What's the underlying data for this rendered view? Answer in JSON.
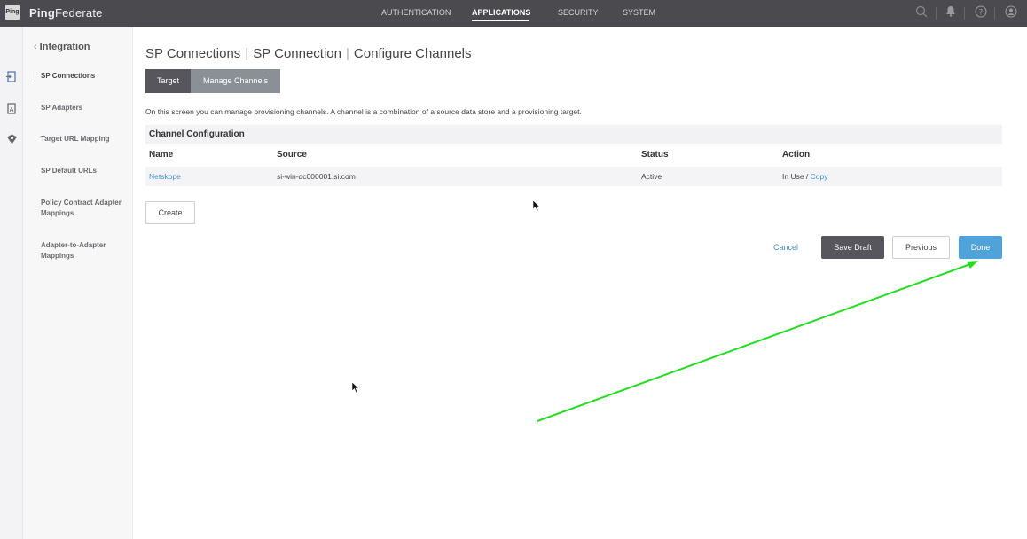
{
  "brand": {
    "logo_text": "Ping",
    "name_bold": "Ping",
    "name_rest": "Federate"
  },
  "topnav": {
    "items": [
      {
        "label": "AUTHENTICATION",
        "active": false
      },
      {
        "label": "APPLICATIONS",
        "active": true
      },
      {
        "label": "SECURITY",
        "active": false
      },
      {
        "label": "SYSTEM",
        "active": false
      }
    ],
    "icons": [
      "search-icon",
      "bell-icon",
      "help-icon",
      "user-icon"
    ]
  },
  "leftrail": {
    "icons": [
      "applications-icon",
      "adapters-icon",
      "integration-icon"
    ]
  },
  "sidebar": {
    "back_label": "Integration",
    "items": [
      {
        "label": "SP Connections",
        "active": true
      },
      {
        "label": "SP Adapters",
        "active": false
      },
      {
        "label": "Target URL Mapping",
        "active": false
      },
      {
        "label": "SP Default URLs",
        "active": false
      },
      {
        "label": "Policy Contract Adapter Mappings",
        "active": false
      },
      {
        "label": "Adapter-to-Adapter Mappings",
        "active": false
      }
    ]
  },
  "breadcrumb": {
    "items": [
      "SP Connections",
      "SP Connection",
      "Configure Channels"
    ]
  },
  "tabs": [
    {
      "label": "Target"
    },
    {
      "label": "Manage Channels"
    }
  ],
  "description": "On this screen you can manage provisioning channels. A channel is a combination of a source data store and a provisioning target.",
  "channel_config": {
    "title": "Channel Configuration",
    "columns": [
      "Name",
      "Source",
      "Status",
      "Action"
    ],
    "rows": [
      {
        "name": "Netskope",
        "source": "si-win-dc000001.si.com",
        "status": "Active",
        "action_text": "In Use / ",
        "action_link": "Copy"
      }
    ]
  },
  "buttons": {
    "create": "Create",
    "cancel": "Cancel",
    "save_draft": "Save Draft",
    "previous": "Previous",
    "done": "Done"
  },
  "annotation": {
    "arrow_color": "#22dd22"
  },
  "colors": {
    "topbar": "#4a4a4f",
    "accent": "#4fa3d9",
    "link": "#4a90c8",
    "dark_button": "#56565c"
  }
}
